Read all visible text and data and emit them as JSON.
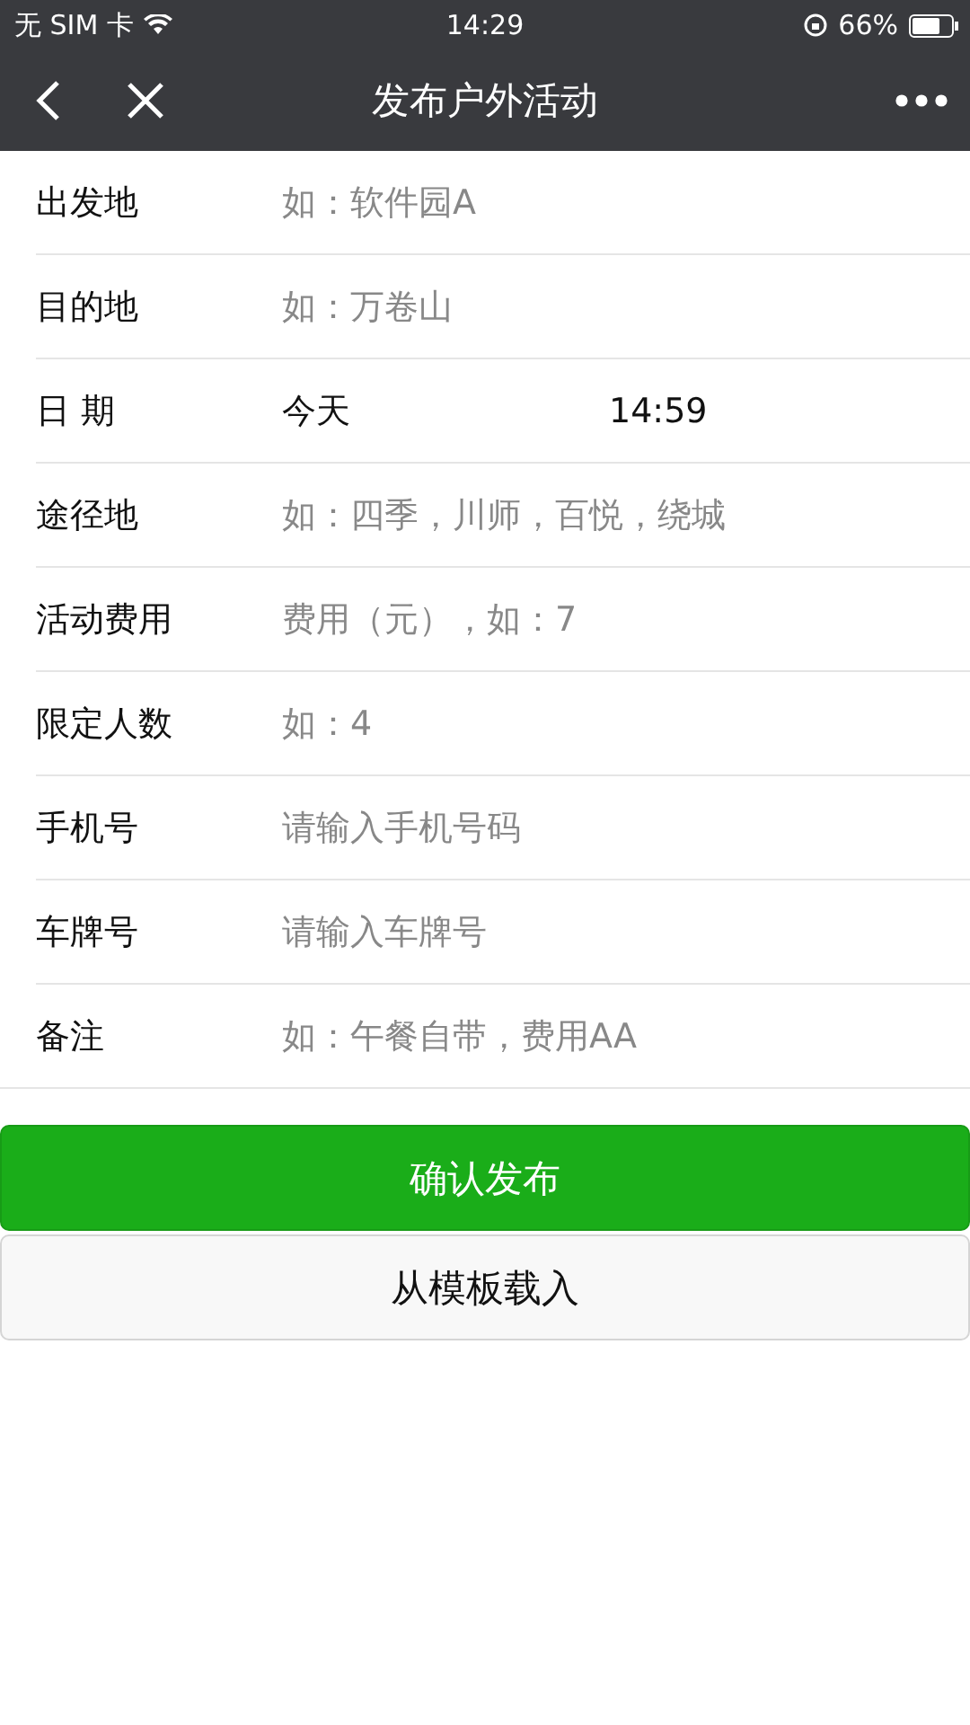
{
  "status_bar": {
    "carrier": "无 SIM 卡",
    "time": "14:29",
    "battery": "66%"
  },
  "nav": {
    "title": "发布户外活动"
  },
  "fields": [
    {
      "kind": "input",
      "label": "出发地",
      "placeholder": "如：软件园A"
    },
    {
      "kind": "input",
      "label": "目的地",
      "placeholder": "如：万卷山"
    },
    {
      "kind": "datetime",
      "label": "日 期",
      "date": "今天",
      "time": "14:59"
    },
    {
      "kind": "input",
      "label": "途径地",
      "placeholder": "如：四季，川师，百悦，绕城"
    },
    {
      "kind": "input",
      "label": "活动费用",
      "placeholder": "费用（元），如：7"
    },
    {
      "kind": "input",
      "label": "限定人数",
      "placeholder": "如：4"
    },
    {
      "kind": "input",
      "label": "手机号",
      "placeholder": "请输入手机号码"
    },
    {
      "kind": "input",
      "label": "车牌号",
      "placeholder": "请输入车牌号"
    },
    {
      "kind": "input",
      "label": "备注",
      "placeholder": "如：午餐自带，费用AA"
    }
  ],
  "buttons": [
    {
      "kind": "primary",
      "label": "确认发布"
    },
    {
      "kind": "default",
      "label": "从模板载入"
    }
  ]
}
